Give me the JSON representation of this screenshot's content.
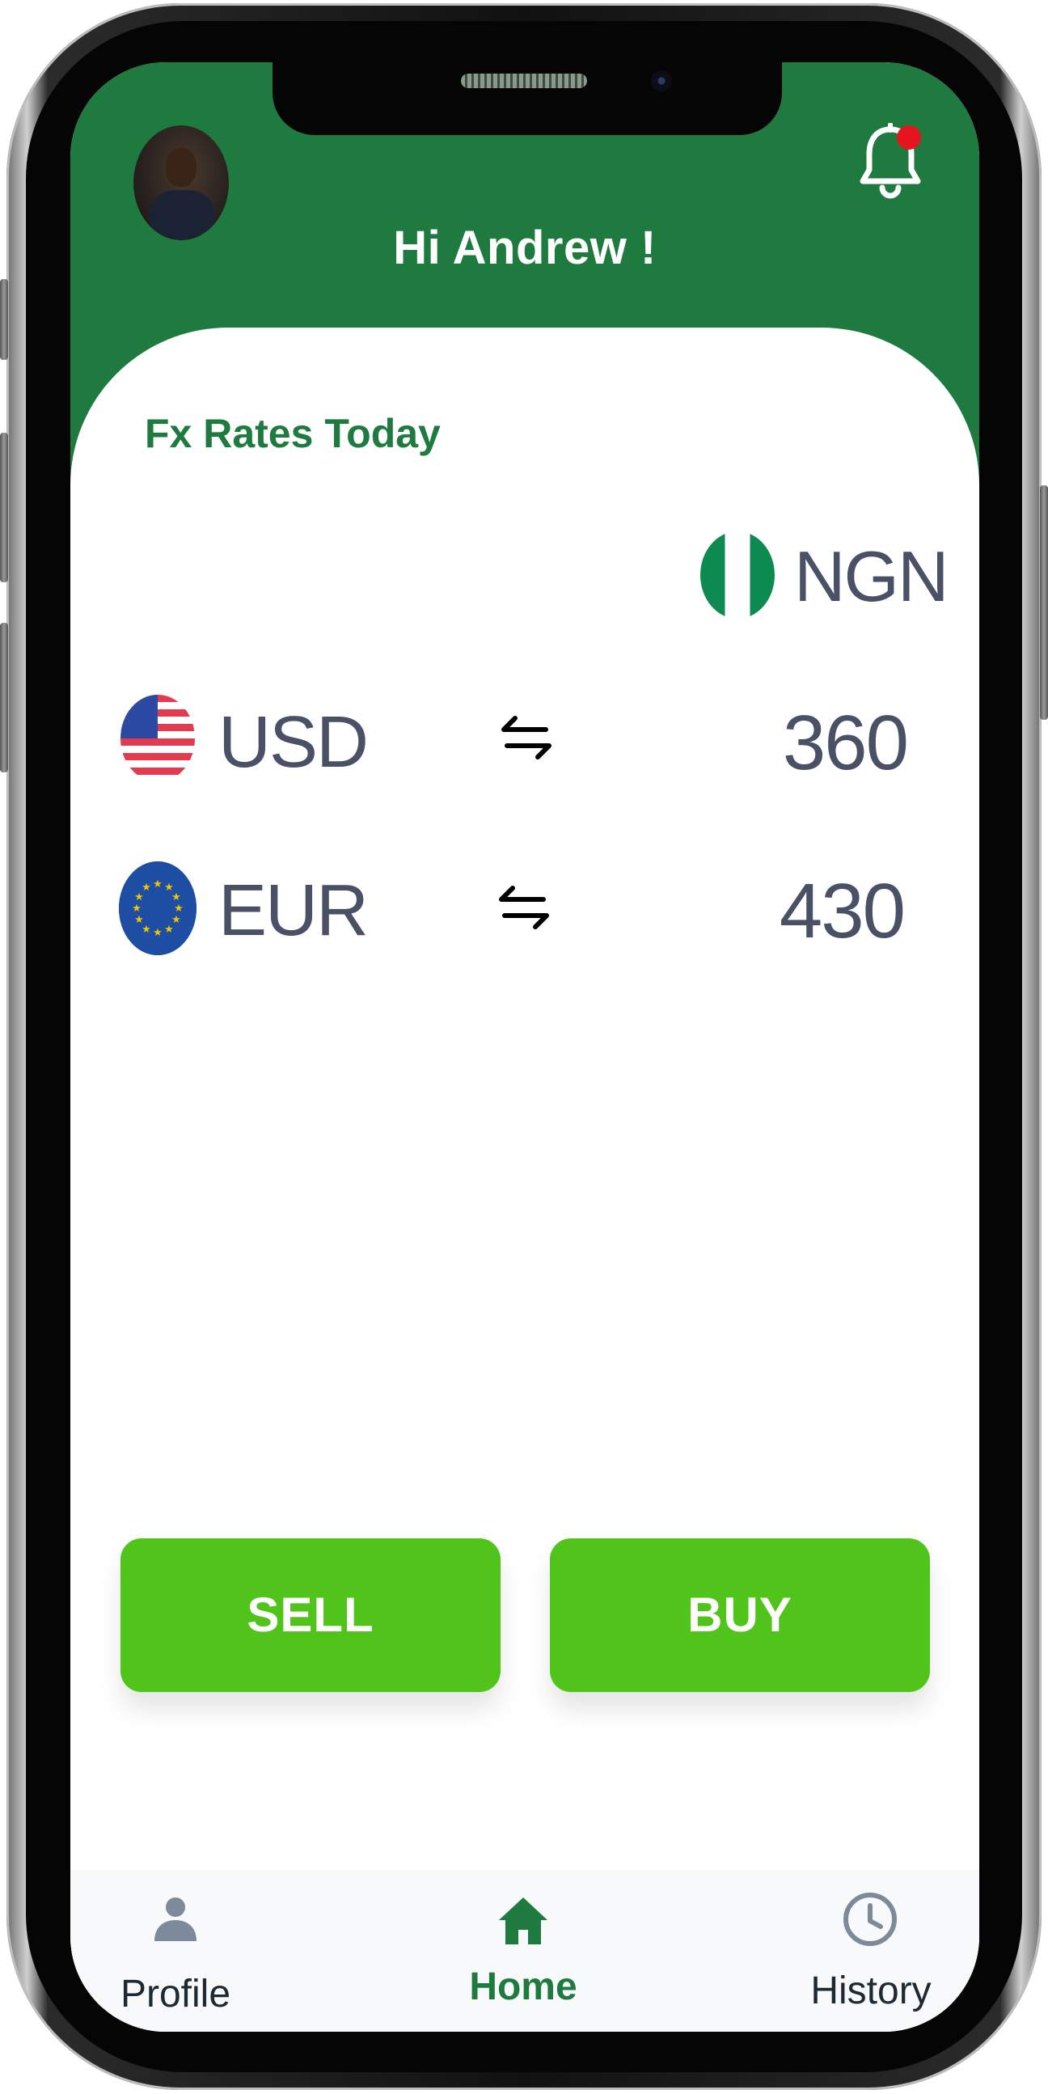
{
  "header": {
    "greeting": "Hi Andrew !"
  },
  "rates": {
    "title": "Fx Rates Today",
    "base_currency": "NGN",
    "rows": [
      {
        "currency": "USD",
        "value": "360"
      },
      {
        "currency": "EUR",
        "value": "430"
      }
    ]
  },
  "actions": {
    "sell_label": "SELL",
    "buy_label": "BUY"
  },
  "nav": {
    "items": [
      {
        "label": "Profile",
        "icon": "user-icon"
      },
      {
        "label": "Home",
        "icon": "home-icon",
        "active": true
      },
      {
        "label": "History",
        "icon": "clock-icon"
      }
    ]
  },
  "colors": {
    "brand_green": "#1f7a3f",
    "button_green": "#51c41b",
    "notification_dot": "#e5141e",
    "text_gray": "#4a5166"
  }
}
